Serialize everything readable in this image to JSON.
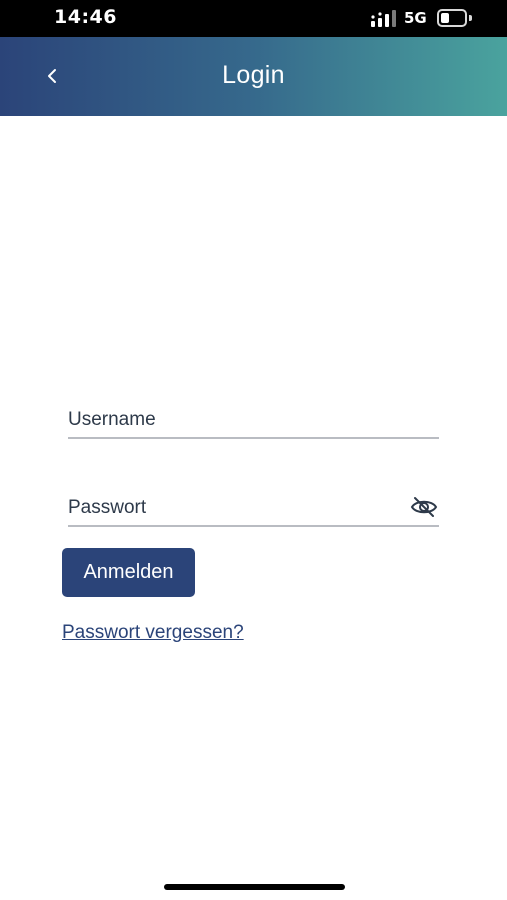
{
  "status_bar": {
    "time": "14:46",
    "network": "5G",
    "signal_icon": "cellular-signal-icon",
    "battery_icon": "battery-icon"
  },
  "header": {
    "title": "Login",
    "back_icon": "chevron-left-icon"
  },
  "form": {
    "username": {
      "placeholder": "Username",
      "value": ""
    },
    "password": {
      "placeholder": "Passwort",
      "value": "",
      "toggle_icon": "eye-slash-icon"
    },
    "submit_label": "Anmelden",
    "forgot_label": "Passwort vergessen?"
  },
  "colors": {
    "primary": "#2b4479",
    "gradient_end": "#4aa39e"
  }
}
